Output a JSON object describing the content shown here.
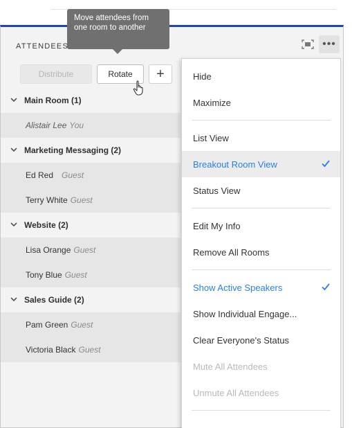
{
  "panel": {
    "title": "ATTENDEES"
  },
  "toolbar": {
    "distribute_label": "Distribute",
    "rotate_label": "Rotate",
    "add_label": "+"
  },
  "tooltip": {
    "text": "Move attendees from one room to another"
  },
  "rooms": [
    {
      "name": "Main Room (1)",
      "attendees": [
        {
          "name": "Alistair Lee",
          "role": "You"
        }
      ]
    },
    {
      "name": "Marketing Messaging (2)",
      "attendees": [
        {
          "name": "Ed Red",
          "role": "Guest"
        },
        {
          "name": "Terry White",
          "role": "Guest"
        }
      ]
    },
    {
      "name": "Website (2)",
      "attendees": [
        {
          "name": "Lisa Orange",
          "role": "Guest"
        },
        {
          "name": "Tony Blue",
          "role": "Guest"
        }
      ]
    },
    {
      "name": "Sales Guide (2)",
      "attendees": [
        {
          "name": "Pam Green",
          "role": "Guest"
        },
        {
          "name": "Victoria Black",
          "role": "Guest"
        }
      ]
    }
  ],
  "menu": {
    "hide": "Hide",
    "maximize": "Maximize",
    "list_view": "List View",
    "breakout_room_view": "Breakout Room View",
    "status_view": "Status View",
    "edit_my_info": "Edit My Info",
    "remove_all_rooms": "Remove All Rooms",
    "show_active_speakers": "Show Active Speakers",
    "show_individual_engagement": "Show Individual Engage...",
    "clear_everyones_status": "Clear Everyone's Status",
    "mute_all_attendees": "Mute All Attendees",
    "unmute_all_attendees": "Unmute All Attendees"
  },
  "colors": {
    "accent_blue": "#2680eb",
    "panel_border_blue": "#1f45a8",
    "tooltip_bg": "#707070"
  },
  "icons": {
    "fit": "fit-to-window-icon",
    "more": "more-options-icon",
    "chevron": "chevron-down-icon",
    "check": "checkmark-icon",
    "cursor": "hand-pointer-icon"
  }
}
